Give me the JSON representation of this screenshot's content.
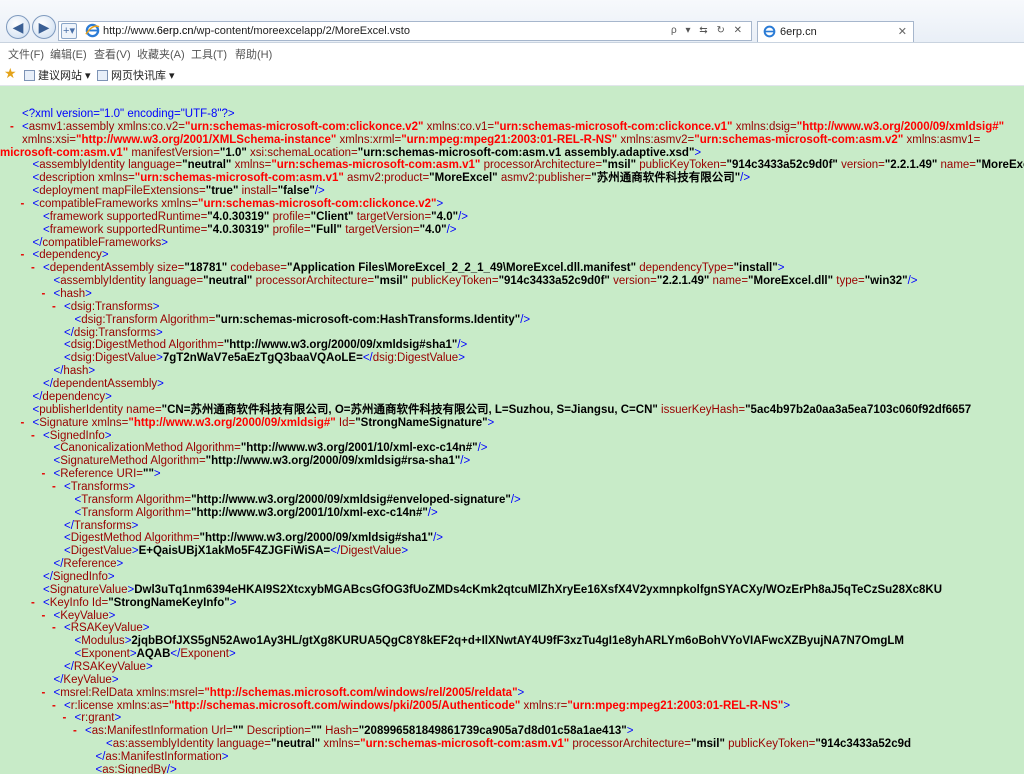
{
  "browser": {
    "url_prefix": "http://www.",
    "url_domain": "6erp.cn",
    "url_path": "/wp-content/moreexcelapp/2/MoreExcel.vsto",
    "search_hint": "ρ ▾ ⇆ ↻ ✕",
    "tab_title": "6erp.cn",
    "tab_close": "✕",
    "back_glyph": "◀",
    "forward_glyph": "▶",
    "page_glyph": "+▾"
  },
  "menu": [
    "文件(F)",
    "编辑(E)",
    "查看(V)",
    "收藏夹(A)",
    "工具(T)",
    "帮助(H)"
  ],
  "favorites": {
    "star_icon": "star-icon",
    "items": [
      "建议网站 ▾",
      "网页快讯库 ▾"
    ]
  },
  "colors": {
    "background": "#c8ebc8",
    "markup": "#0000ff",
    "name": "#990000",
    "namespace_value": "#ff0000",
    "collapse_marker": "#e60000"
  },
  "xml_lines": [
    {
      "i": 0,
      "m": "",
      "h": "<span class='pi'>&lt;?xml version=&quot;1.0&quot; encoding=&quot;UTF-8&quot;?&gt;</span>"
    },
    {
      "i": 0,
      "m": "-",
      "h": "<span class='b'>&lt;</span><span class='t'>asmv1:assembly</span> <span class='a'>xmlns:co.v2=</span><span class='ns'>&quot;urn:schemas-microsoft-com:clickonce.v2&quot;</span> <span class='a'>xmlns:co.v1=</span><span class='ns'>&quot;urn:schemas-microsoft-com:clickonce.v1&quot;</span> <span class='a'>xmlns:dsig=</span><span class='ns'>&quot;http://www.w3.org/2000/09/xmldsig#&quot;</span>"
    },
    {
      "i": 0,
      "m": "",
      "h": "<span class='a'>xmlns:xsi=</span><span class='ns'>&quot;http://www.w3.org/2001/XMLSchema-instance&quot;</span> <span class='a'>xmlns:xrml=</span><span class='ns'>&quot;urn:mpeg:mpeg21:2003:01-REL-R-NS&quot;</span> <span class='a'>xmlns:asmv2=</span><span class='ns'>&quot;urn:schemas-microsoft-com:asm.v2&quot;</span> <span class='a'>xmlns:asmv1=</span>"
    },
    {
      "i": -1,
      "m": "",
      "h": "<span class='ns'>microsoft-com:asm.v1&quot;</span> <span class='a'>manifestVersion=</span><span class='v'>&quot;1.0&quot;</span> <span class='a'>xsi:schemaLocation=</span><span class='v'>&quot;urn:schemas-microsoft-com:asm.v1 assembly.adaptive.xsd&quot;</span><span class='b'>&gt;</span>"
    },
    {
      "i": 1,
      "m": "",
      "h": "<span class='b'>&lt;</span><span class='t'>assemblyIdentity</span> <span class='a'>language=</span><span class='v'>&quot;neutral&quot;</span> <span class='a'>xmlns=</span><span class='ns'>&quot;urn:schemas-microsoft-com:asm.v1&quot;</span> <span class='a'>processorArchitecture=</span><span class='v'>&quot;msil&quot;</span> <span class='a'>publicKeyToken=</span><span class='v'>&quot;914c3433a52c9d0f&quot;</span> <span class='a'>version=</span><span class='v'>&quot;2.2.1.49&quot;</span> <span class='a'>name=</span><span class='v'>&quot;MoreExcel.vsto&quot;</span><span class='b'>/&gt;</span>"
    },
    {
      "i": 1,
      "m": "",
      "h": "<span class='b'>&lt;</span><span class='t'>description</span> <span class='a'>xmlns=</span><span class='ns'>&quot;urn:schemas-microsoft-com:asm.v1&quot;</span> <span class='a'>asmv2:product=</span><span class='v'>&quot;MoreExcel&quot;</span> <span class='a'>asmv2:publisher=</span><span class='v'>&quot;苏州通商软件科技有限公司&quot;</span><span class='b'>/&gt;</span>"
    },
    {
      "i": 1,
      "m": "",
      "h": "<span class='b'>&lt;</span><span class='t'>deployment</span> <span class='a'>mapFileExtensions=</span><span class='v'>&quot;true&quot;</span> <span class='a'>install=</span><span class='v'>&quot;false&quot;</span><span class='b'>/&gt;</span>"
    },
    {
      "i": 1,
      "m": "-",
      "h": "<span class='b'>&lt;</span><span class='t'>compatibleFrameworks</span> <span class='a'>xmlns=</span><span class='ns'>&quot;urn:schemas-microsoft-com:clickonce.v2&quot;</span><span class='b'>&gt;</span>"
    },
    {
      "i": 2,
      "m": "",
      "h": "<span class='b'>&lt;</span><span class='t'>framework</span> <span class='a'>supportedRuntime=</span><span class='v'>&quot;4.0.30319&quot;</span> <span class='a'>profile=</span><span class='v'>&quot;Client&quot;</span> <span class='a'>targetVersion=</span><span class='v'>&quot;4.0&quot;</span><span class='b'>/&gt;</span>"
    },
    {
      "i": 2,
      "m": "",
      "h": "<span class='b'>&lt;</span><span class='t'>framework</span> <span class='a'>supportedRuntime=</span><span class='v'>&quot;4.0.30319&quot;</span> <span class='a'>profile=</span><span class='v'>&quot;Full&quot;</span> <span class='a'>targetVersion=</span><span class='v'>&quot;4.0&quot;</span><span class='b'>/&gt;</span>"
    },
    {
      "i": 1,
      "m": "",
      "h": "<span class='b'>&lt;/</span><span class='t'>compatibleFrameworks</span><span class='b'>&gt;</span>"
    },
    {
      "i": 1,
      "m": "-",
      "h": "<span class='b'>&lt;</span><span class='t'>dependency</span><span class='b'>&gt;</span>"
    },
    {
      "i": 2,
      "m": "-",
      "h": "<span class='b'>&lt;</span><span class='t'>dependentAssembly</span> <span class='a'>size=</span><span class='v'>&quot;18781&quot;</span> <span class='a'>codebase=</span><span class='v'>&quot;Application Files\\MoreExcel_2_2_1_49\\MoreExcel.dll.manifest&quot;</span> <span class='a'>dependencyType=</span><span class='v'>&quot;install&quot;</span><span class='b'>&gt;</span>"
    },
    {
      "i": 3,
      "m": "",
      "h": "<span class='b'>&lt;</span><span class='t'>assemblyIdentity</span> <span class='a'>language=</span><span class='v'>&quot;neutral&quot;</span> <span class='a'>processorArchitecture=</span><span class='v'>&quot;msil&quot;</span> <span class='a'>publicKeyToken=</span><span class='v'>&quot;914c3433a52c9d0f&quot;</span> <span class='a'>version=</span><span class='v'>&quot;2.2.1.49&quot;</span> <span class='a'>name=</span><span class='v'>&quot;MoreExcel.dll&quot;</span> <span class='a'>type=</span><span class='v'>&quot;win32&quot;</span><span class='b'>/&gt;</span>"
    },
    {
      "i": 3,
      "m": "-",
      "h": "<span class='b'>&lt;</span><span class='t'>hash</span><span class='b'>&gt;</span>"
    },
    {
      "i": 4,
      "m": "-",
      "h": "<span class='b'>&lt;</span><span class='t'>dsig:Transforms</span><span class='b'>&gt;</span>"
    },
    {
      "i": 5,
      "m": "",
      "h": "<span class='b'>&lt;</span><span class='t'>dsig:Transform</span> <span class='a'>Algorithm=</span><span class='v'>&quot;urn:schemas-microsoft-com:HashTransforms.Identity&quot;</span><span class='b'>/&gt;</span>"
    },
    {
      "i": 4,
      "m": "",
      "h": "<span class='b'>&lt;/</span><span class='t'>dsig:Transforms</span><span class='b'>&gt;</span>"
    },
    {
      "i": 4,
      "m": "",
      "h": "<span class='b'>&lt;</span><span class='t'>dsig:DigestMethod</span> <span class='a'>Algorithm=</span><span class='v'>&quot;http://www.w3.org/2000/09/xmldsig#sha1&quot;</span><span class='b'>/&gt;</span>"
    },
    {
      "i": 4,
      "m": "",
      "h": "<span class='b'>&lt;</span><span class='t'>dsig:DigestValue</span><span class='b'>&gt;</span><span class='tx'>7gT2nWaV7e5aEzTgQ3baaVQAoLE=</span><span class='b'>&lt;/</span><span class='t'>dsig:DigestValue</span><span class='b'>&gt;</span>"
    },
    {
      "i": 3,
      "m": "",
      "h": "<span class='b'>&lt;/</span><span class='t'>hash</span><span class='b'>&gt;</span>"
    },
    {
      "i": 2,
      "m": "",
      "h": "<span class='b'>&lt;/</span><span class='t'>dependentAssembly</span><span class='b'>&gt;</span>"
    },
    {
      "i": 1,
      "m": "",
      "h": "<span class='b'>&lt;/</span><span class='t'>dependency</span><span class='b'>&gt;</span>"
    },
    {
      "i": 1,
      "m": "",
      "h": "<span class='b'>&lt;</span><span class='t'>publisherIdentity</span> <span class='a'>name=</span><span class='v'>&quot;CN=苏州通商软件科技有限公司, O=苏州通商软件科技有限公司, L=Suzhou, S=Jiangsu, C=CN&quot;</span> <span class='a'>issuerKeyHash=</span><span class='v'>&quot;5ac4b97b2a0aa3a5ea7103c060f92df6657</span>"
    },
    {
      "i": 1,
      "m": "-",
      "h": "<span class='b'>&lt;</span><span class='t'>Signature</span> <span class='a'>xmlns=</span><span class='ns'>&quot;http://www.w3.org/2000/09/xmldsig#&quot;</span> <span class='a'>Id=</span><span class='v'>&quot;StrongNameSignature&quot;</span><span class='b'>&gt;</span>"
    },
    {
      "i": 2,
      "m": "-",
      "h": "<span class='b'>&lt;</span><span class='t'>SignedInfo</span><span class='b'>&gt;</span>"
    },
    {
      "i": 3,
      "m": "",
      "h": "<span class='b'>&lt;</span><span class='t'>CanonicalizationMethod</span> <span class='a'>Algorithm=</span><span class='v'>&quot;http://www.w3.org/2001/10/xml-exc-c14n#&quot;</span><span class='b'>/&gt;</span>"
    },
    {
      "i": 3,
      "m": "",
      "h": "<span class='b'>&lt;</span><span class='t'>SignatureMethod</span> <span class='a'>Algorithm=</span><span class='v'>&quot;http://www.w3.org/2000/09/xmldsig#rsa-sha1&quot;</span><span class='b'>/&gt;</span>"
    },
    {
      "i": 3,
      "m": "-",
      "h": "<span class='b'>&lt;</span><span class='t'>Reference</span> <span class='a'>URI=</span><span class='v'>&quot;&quot;</span><span class='b'>&gt;</span>"
    },
    {
      "i": 4,
      "m": "-",
      "h": "<span class='b'>&lt;</span><span class='t'>Transforms</span><span class='b'>&gt;</span>"
    },
    {
      "i": 5,
      "m": "",
      "h": "<span class='b'>&lt;</span><span class='t'>Transform</span> <span class='a'>Algorithm=</span><span class='v'>&quot;http://www.w3.org/2000/09/xmldsig#enveloped-signature&quot;</span><span class='b'>/&gt;</span>"
    },
    {
      "i": 5,
      "m": "",
      "h": "<span class='b'>&lt;</span><span class='t'>Transform</span> <span class='a'>Algorithm=</span><span class='v'>&quot;http://www.w3.org/2001/10/xml-exc-c14n#&quot;</span><span class='b'>/&gt;</span>"
    },
    {
      "i": 4,
      "m": "",
      "h": "<span class='b'>&lt;/</span><span class='t'>Transforms</span><span class='b'>&gt;</span>"
    },
    {
      "i": 4,
      "m": "",
      "h": "<span class='b'>&lt;</span><span class='t'>DigestMethod</span> <span class='a'>Algorithm=</span><span class='v'>&quot;http://www.w3.org/2000/09/xmldsig#sha1&quot;</span><span class='b'>/&gt;</span>"
    },
    {
      "i": 4,
      "m": "",
      "h": "<span class='b'>&lt;</span><span class='t'>DigestValue</span><span class='b'>&gt;</span><span class='tx'>E+QaisUBjX1akMo5F4ZJGFiWiSA=</span><span class='b'>&lt;/</span><span class='t'>DigestValue</span><span class='b'>&gt;</span>"
    },
    {
      "i": 3,
      "m": "",
      "h": "<span class='b'>&lt;/</span><span class='t'>Reference</span><span class='b'>&gt;</span>"
    },
    {
      "i": 2,
      "m": "",
      "h": "<span class='b'>&lt;/</span><span class='t'>SignedInfo</span><span class='b'>&gt;</span>"
    },
    {
      "i": 2,
      "m": "",
      "h": "<span class='b'>&lt;</span><span class='t'>SignatureValue</span><span class='b'>&gt;</span><span class='tx'>Dwl3uTq1nm6394eHKAI9S2XtcxybMGABcsGfOG3fUoZMDs4cKmk2qtcuMlZhXryEe16XsfX4V2yxmnpkolfgnSYACXy/WOzErPh8aJ5qTeCzSu28Xc8KU</span>"
    },
    {
      "i": 2,
      "m": "-",
      "h": "<span class='b'>&lt;</span><span class='t'>KeyInfo</span> <span class='a'>Id=</span><span class='v'>&quot;StrongNameKeyInfo&quot;</span><span class='b'>&gt;</span>"
    },
    {
      "i": 3,
      "m": "-",
      "h": "<span class='b'>&lt;</span><span class='t'>KeyValue</span><span class='b'>&gt;</span>"
    },
    {
      "i": 4,
      "m": "-",
      "h": "<span class='b'>&lt;</span><span class='t'>RSAKeyValue</span><span class='b'>&gt;</span>"
    },
    {
      "i": 5,
      "m": "",
      "h": "<span class='b'>&lt;</span><span class='t'>Modulus</span><span class='b'>&gt;</span><span class='tx'>2jqbBOfJXS5gN52Awo1Ay3HL/gtXg8KURUA5QgC8Y8kEF2q+d+IlXNwtAY4U9fF3xzTu4gI1e8yhARLYm6oBohVYoVIAFwcXZByujNA7N7OmgLM</span>"
    },
    {
      "i": 5,
      "m": "",
      "h": "<span class='b'>&lt;</span><span class='t'>Exponent</span><span class='b'>&gt;</span><span class='tx'>AQAB</span><span class='b'>&lt;/</span><span class='t'>Exponent</span><span class='b'>&gt;</span>"
    },
    {
      "i": 4,
      "m": "",
      "h": "<span class='b'>&lt;/</span><span class='t'>RSAKeyValue</span><span class='b'>&gt;</span>"
    },
    {
      "i": 3,
      "m": "",
      "h": "<span class='b'>&lt;/</span><span class='t'>KeyValue</span><span class='b'>&gt;</span>"
    },
    {
      "i": 3,
      "m": "-",
      "h": "<span class='b'>&lt;</span><span class='t'>msrel:RelData</span> <span class='a'>xmlns:msrel=</span><span class='ns'>&quot;http://schemas.microsoft.com/windows/rel/2005/reldata&quot;</span><span class='b'>&gt;</span>"
    },
    {
      "i": 4,
      "m": "-",
      "h": "<span class='b'>&lt;</span><span class='t'>r:license</span> <span class='a'>xmlns:as=</span><span class='ns'>&quot;http://schemas.microsoft.com/windows/pki/2005/Authenticode&quot;</span> <span class='a'>xmlns:r=</span><span class='ns'>&quot;urn:mpeg:mpeg21:2003:01-REL-R-NS&quot;</span><span class='b'>&gt;</span>"
    },
    {
      "i": 5,
      "m": "-",
      "h": "<span class='b'>&lt;</span><span class='t'>r:grant</span><span class='b'>&gt;</span>"
    },
    {
      "i": 6,
      "m": "-",
      "h": "<span class='b'>&lt;</span><span class='t'>as:ManifestInformation</span> <span class='a'>Url=</span><span class='v'>&quot;&quot;</span> <span class='a'>Description=</span><span class='v'>&quot;&quot;</span> <span class='a'>Hash=</span><span class='v'>&quot;208996581849861739ca905a7d8d01c58a1ae413&quot;</span><span class='b'>&gt;</span>"
    },
    {
      "i": 8,
      "m": "",
      "h": "<span class='b'>&lt;</span><span class='t'>as:assemblyIdentity</span> <span class='a'>language=</span><span class='v'>&quot;neutral&quot;</span> <span class='a'>xmlns=</span><span class='ns'>&quot;urn:schemas-microsoft-com:asm.v1&quot;</span> <span class='a'>processorArchitecture=</span><span class='v'>&quot;msil&quot;</span> <span class='a'>publicKeyToken=</span><span class='v'>&quot;914c3433a52c9d</span>"
    },
    {
      "i": 7,
      "m": "",
      "h": "<span class='b'>&lt;/</span><span class='t'>as:ManifestInformation</span><span class='b'>&gt;</span>"
    },
    {
      "i": 7,
      "m": "",
      "h": "<span class='b'>&lt;</span><span class='t'>as:SignedBy</span><span class='b'>/&gt;</span>"
    }
  ]
}
